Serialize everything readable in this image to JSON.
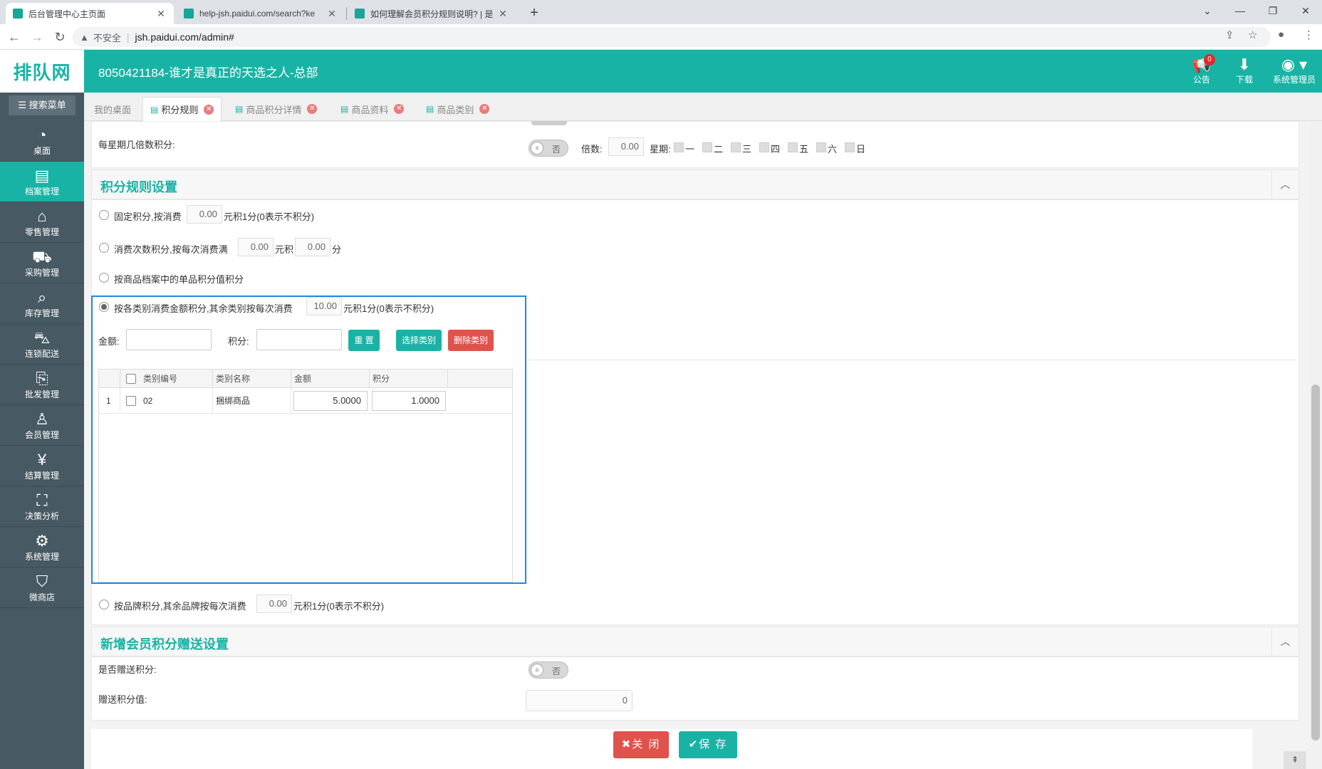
{
  "browser": {
    "tabs": [
      {
        "title": "后台管理中心主页面",
        "close": "✕"
      },
      {
        "title": "help-jsh.paidui.com/search?ke",
        "close": "✕"
      },
      {
        "title": "如何理解会员积分规则说明? | 是",
        "close": "✕"
      }
    ],
    "new_tab": "+",
    "insecure_label": "不安全",
    "url": "jsh.paidui.com/admin#"
  },
  "header": {
    "logo": "排队网",
    "org_title": "8050421184-谁才是真正的天选之人-总部",
    "notice_label": "公告",
    "notice_count": "0",
    "download_label": "下载",
    "user_label": "系统管理员"
  },
  "sidebar": {
    "search_label": "搜索菜单",
    "items": [
      {
        "label": "桌面",
        "icon": "dashboard-icon"
      },
      {
        "label": "档案管理",
        "icon": "archive-icon"
      },
      {
        "label": "零售管理",
        "icon": "store-icon"
      },
      {
        "label": "采购管理",
        "icon": "cart-icon"
      },
      {
        "label": "库存管理",
        "icon": "inventory-icon"
      },
      {
        "label": "连锁配送",
        "icon": "truck-icon"
      },
      {
        "label": "批发管理",
        "icon": "wholesale-icon"
      },
      {
        "label": "会员管理",
        "icon": "member-icon"
      },
      {
        "label": "结算管理",
        "icon": "settlement-icon"
      },
      {
        "label": "决策分析",
        "icon": "chart-icon"
      },
      {
        "label": "系统管理",
        "icon": "gear-icon"
      },
      {
        "label": "微商店",
        "icon": "shop-icon"
      }
    ],
    "active_index": 1
  },
  "page_tabs": [
    {
      "label": "我的桌面"
    },
    {
      "label": "积分规则"
    },
    {
      "label": "商品积分详情"
    },
    {
      "label": "商品资料"
    },
    {
      "label": "商品类别"
    }
  ],
  "weekly": {
    "label": "每星期几倍数积分:",
    "toggle_text": "否",
    "multiple_label": "倍数:",
    "multiple_value": "0.00",
    "week_label": "星期:",
    "days": [
      "一",
      "二",
      "三",
      "四",
      "五",
      "六",
      "日"
    ]
  },
  "rules_section": {
    "title": "积分规则设置",
    "opt1_prefix": "固定积分,按消费",
    "opt1_value": "0.00",
    "opt1_suffix": "元积1分(0表示不积分)",
    "opt2_prefix": "消费次数积分,按每次消费满",
    "opt2_value1": "0.00",
    "opt2_mid": "元积",
    "opt2_value2": "0.00",
    "opt2_suffix": "分",
    "opt3_label": "按商品档案中的单品积分值积分",
    "opt4_prefix": "按各类别消费金额积分,其余类别按每次消费",
    "opt4_value": "10.00",
    "opt4_suffix": "元积1分(0表示不积分)",
    "amount_label": "金额:",
    "points_label": "积分:",
    "btn_reset": "重 置",
    "btn_select": "选择类别",
    "btn_delete": "删除类别",
    "grid": {
      "headers": [
        "类别编号",
        "类别名称",
        "金额",
        "积分"
      ],
      "rows": [
        {
          "index": "1",
          "code": "02",
          "name": "捆绑商品",
          "amount": "5.0000",
          "points": "1.0000"
        }
      ]
    },
    "opt5_prefix": "按品牌积分,其余品牌按每次消费",
    "opt5_value": "0.00",
    "opt5_suffix": "元积1分(0表示不积分)"
  },
  "gift_section": {
    "title": "新增会员积分赠送设置",
    "give_label": "是否赠送积分:",
    "toggle_text": "否",
    "value_label": "赠送积分值:",
    "value": "0"
  },
  "footer": {
    "close_label": "✖关 闭",
    "save_label": "✔保 存"
  }
}
